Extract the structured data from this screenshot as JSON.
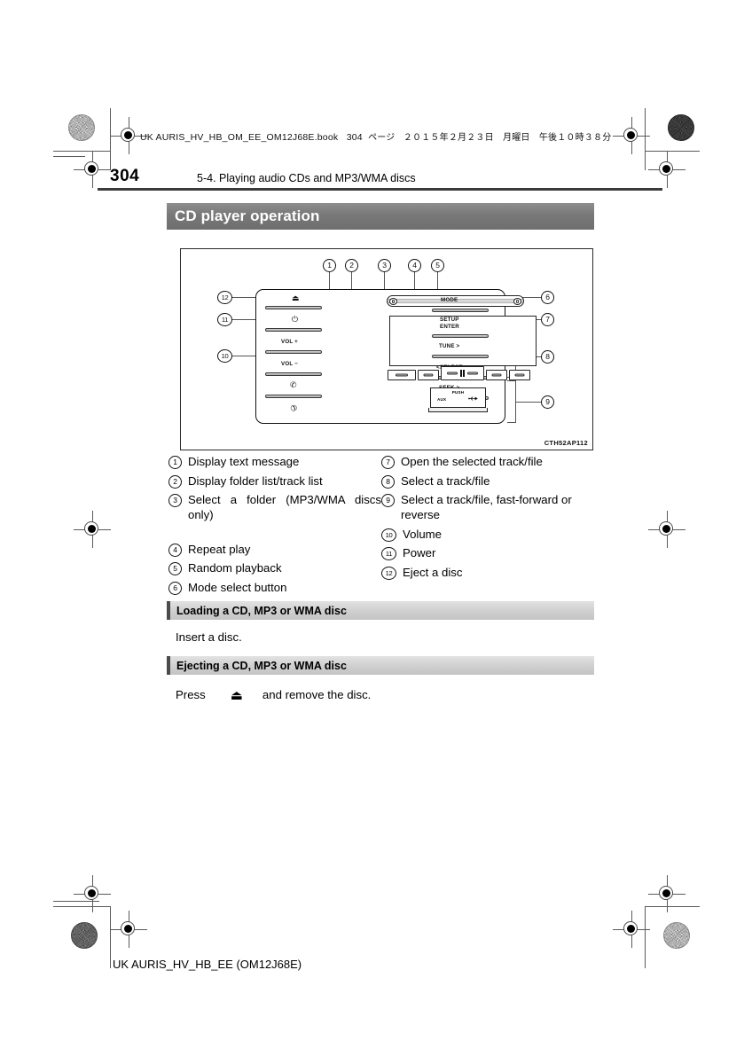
{
  "page": {
    "book_line": "UK AURIS_HV_HB_OM_EE_OM12J68E.book",
    "book_page": "304",
    "book_page_unit": "ページ",
    "book_date": "２０１５年２月２３日　月曜日　午後１０時３８分",
    "page_number": "304",
    "chapter_title": "5-4. Playing audio CDs and MP3/WMA discs",
    "footer": "UK AURIS_HV_HB_EE (OM12J68E)"
  },
  "title_banner": {
    "text": "CD player operation"
  },
  "figure": {
    "code": "CTH52AP112",
    "unit_labels": {
      "eject": "⏏",
      "power": "⏻",
      "vol_up": "VOL +",
      "vol_down": "VOL −",
      "phone_call": "✆",
      "phone_end": "✆",
      "mode": "MODE",
      "setup": "SETUP",
      "enter": "ENTER",
      "tune": "TUNE >",
      "select": "<SELECT",
      "seek": "SEEK >",
      "track": "<TRACK",
      "push": "PUSH",
      "aux": "AUX",
      "usb": "usb-icon"
    },
    "callouts": [
      "1",
      "2",
      "3",
      "4",
      "5",
      "6",
      "7",
      "8",
      "9",
      "10",
      "11",
      "12"
    ]
  },
  "legend": {
    "left": [
      {
        "num": "1",
        "text": "Display text message"
      },
      {
        "num": "2",
        "text": "Display folder list/track list"
      },
      {
        "num": "3",
        "text": "Select a folder (MP3/WMA discs only)"
      },
      {
        "num": "4",
        "text": "Repeat play"
      },
      {
        "num": "5",
        "text": "Random playback"
      },
      {
        "num": "6",
        "text": "Mode select button"
      }
    ],
    "right": [
      {
        "num": "7",
        "text": "Open the selected track/file"
      },
      {
        "num": "8",
        "text": "Select a track/file"
      },
      {
        "num": "9",
        "text": "Select a track/file, fast-forward or reverse"
      },
      {
        "num": "10",
        "text": "Volume"
      },
      {
        "num": "11",
        "text": "Power"
      },
      {
        "num": "12",
        "text": "Eject a disc"
      }
    ]
  },
  "sections": [
    {
      "heading": "Loading a CD, MP3 or WMA disc",
      "body": "Insert a disc."
    },
    {
      "heading": "Ejecting a CD, MP3 or WMA disc",
      "body_before": "Press",
      "glyph": "⏏",
      "body_after": "and remove the disc."
    }
  ],
  "colors": {
    "banner": "#787878",
    "section_header": "#cfcfcf",
    "rule": "#3b3b3b"
  }
}
